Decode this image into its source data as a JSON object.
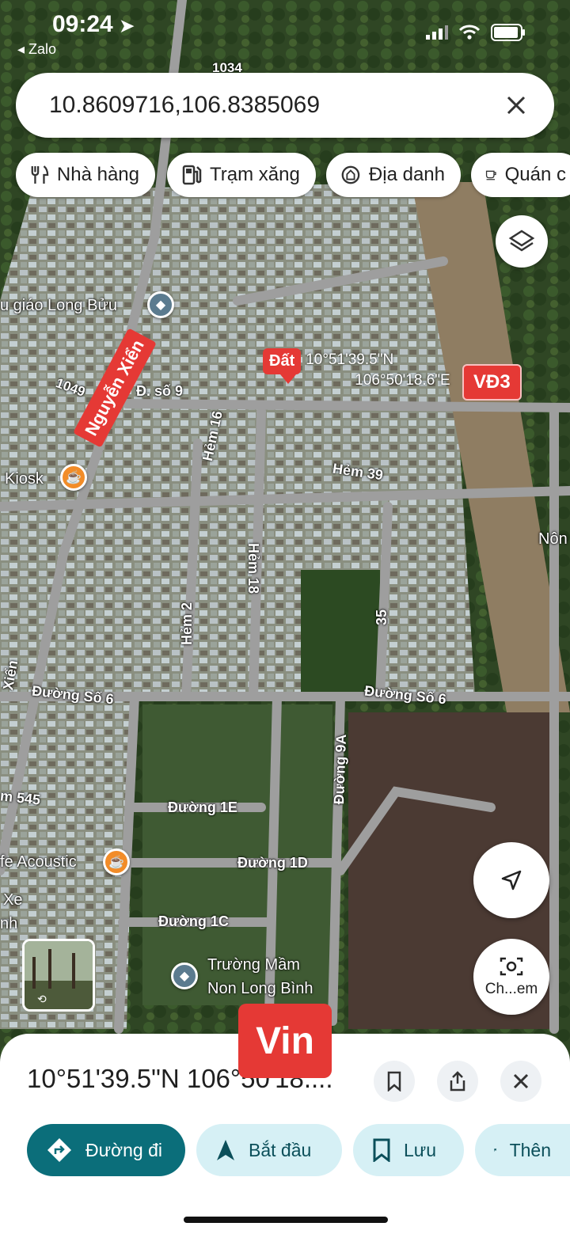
{
  "status_bar": {
    "time": "09:24",
    "back_app": "◂ Zalo"
  },
  "search": {
    "value": "10.8609716,106.8385069"
  },
  "chips": [
    {
      "label": "Nhà hàng",
      "icon": "restaurant-icon"
    },
    {
      "label": "Trạm xăng",
      "icon": "gas-station-icon"
    },
    {
      "label": "Địa danh",
      "icon": "landmark-icon"
    },
    {
      "label": "Quán c",
      "icon": "cafe-icon"
    }
  ],
  "pin": {
    "label": "Đất",
    "lat": "10°51'39.5\"N",
    "lng": "106°50'18.6\"E"
  },
  "badges": {
    "vd3": "VĐ3",
    "road": "Nguyễn Xiển",
    "vin": "Vin"
  },
  "map_labels": {
    "top_road": "1034",
    "school1": "u giáo Long Bửu",
    "r1049": "1049",
    "dso9": "Đ. số 9",
    "kiosk": "Kiosk",
    "hem16": "Hẻm 16",
    "hem39": "Hẻm 39",
    "non": "Nôn",
    "hem18": "Hẻm 18",
    "hem2": "Hẻm 2",
    "r35": "35",
    "xien": "Xiển",
    "dso6a": "Đường Số 6",
    "dso6b": "Đường Số 6",
    "d9a": "Đường 9A",
    "m545": "m 545",
    "d1e": "Đường 1E",
    "acoustic": "fe Acoustic",
    "d1d": "Đường 1D",
    "xe": "Xe",
    "nh": "nh",
    "d1c": "Đường 1C",
    "school2_l1": "Trường Mầm",
    "school2_l2": "Non Long Bình",
    "camera": "Ch...em"
  },
  "sheet": {
    "coords": "10°51'39.5\"N 106°50'18....",
    "buttons": {
      "directions": "Đường đi",
      "start": "Bắt đầu",
      "save": "Lưu",
      "more": "Thên"
    }
  }
}
